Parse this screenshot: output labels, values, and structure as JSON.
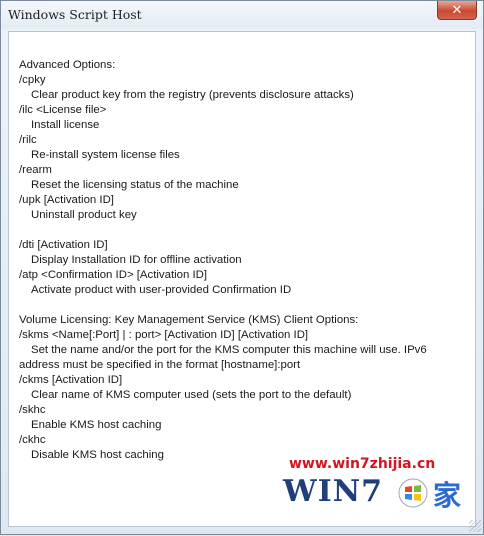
{
  "window": {
    "title": "Windows Script Host",
    "close_glyph": "✕"
  },
  "lines": [
    {
      "text": "Advanced Options:",
      "indent": false
    },
    {
      "text": "/cpky",
      "indent": false
    },
    {
      "text": "Clear product key from the registry (prevents disclosure attacks)",
      "indent": true
    },
    {
      "text": "/ilc <License file>",
      "indent": false
    },
    {
      "text": "Install license",
      "indent": true
    },
    {
      "text": "/rilc",
      "indent": false
    },
    {
      "text": "Re-install system license files",
      "indent": true
    },
    {
      "text": "/rearm",
      "indent": false
    },
    {
      "text": "Reset the licensing status of the machine",
      "indent": true
    },
    {
      "text": "/upk [Activation ID]",
      "indent": false
    },
    {
      "text": "Uninstall product key",
      "indent": true
    },
    {
      "text": "",
      "indent": false
    },
    {
      "text": "/dti [Activation ID]",
      "indent": false
    },
    {
      "text": "Display Installation ID for offline activation",
      "indent": true
    },
    {
      "text": "/atp <Confirmation ID> [Activation ID]",
      "indent": false
    },
    {
      "text": "Activate product with user-provided Confirmation ID",
      "indent": true
    },
    {
      "text": "",
      "indent": false
    },
    {
      "text": "Volume Licensing: Key Management Service (KMS) Client Options:",
      "indent": false
    },
    {
      "text": "/skms <Name[:Port] | : port> [Activation ID] [Activation ID]",
      "indent": false
    },
    {
      "text": "Set the name and/or the port for the KMS computer this machine will use. IPv6",
      "indent": true
    },
    {
      "text": "address must be specified in the format [hostname]:port",
      "indent": false
    },
    {
      "text": "/ckms [Activation ID]",
      "indent": false
    },
    {
      "text": "Clear name of KMS computer used (sets the port to the default)",
      "indent": true
    },
    {
      "text": "/skhc",
      "indent": false
    },
    {
      "text": "Enable KMS host caching",
      "indent": true
    },
    {
      "text": "/ckhc",
      "indent": false
    },
    {
      "text": "Disable KMS host caching",
      "indent": true
    }
  ],
  "watermark": {
    "url": "www.win7zhijia.cn",
    "logo": "WIN7",
    "jia": "家",
    "flag_icon": "windows-flag-icon",
    "colors": {
      "url": "#d4141e",
      "logo": "#1f3e7a"
    }
  }
}
